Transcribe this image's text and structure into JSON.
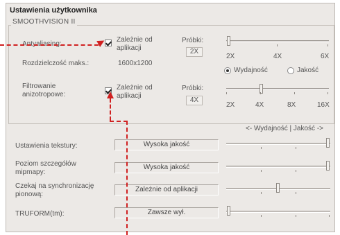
{
  "title": "Ustawienia użytkownika",
  "group_label": "SMOOTHVISION II",
  "antialiasing": {
    "label": "Antyaliasing:",
    "checkbox_label": "Zależnie od aplikacji",
    "probki_label": "Próbki:",
    "probki_value": "2X",
    "ticks": [
      "2X",
      "4X",
      "6X"
    ],
    "slider_level": 0
  },
  "resolution": {
    "label": "Rozdzielczość maks.:",
    "value": "1600x1200"
  },
  "mode": {
    "option1": "Wydajność",
    "option2": "Jakość",
    "selected": "Wydajność"
  },
  "anisotropic": {
    "label": "Filtrowanie anizotropowe:",
    "checkbox_label": "Zależnie od aplikacji",
    "probki_label": "Próbki:",
    "probki_value": "4X",
    "ticks": [
      "2X",
      "4X",
      "8X",
      "16X"
    ],
    "slider_level": 0.33
  },
  "scale_hint": "<- Wydajność | Jakość ->",
  "settings": [
    {
      "label": "Ustawienia tekstury:",
      "value": "Wysoka jakość",
      "level": 1.0
    },
    {
      "label": "Poziom szczegółów mipmapy:",
      "value": "Wysoka jakość",
      "level": 1.0
    },
    {
      "label": "Czekaj na synchronizację pionową:",
      "value": "Zależnie od aplikacji",
      "level": 0.5
    },
    {
      "label": "TRUFORM(tm):",
      "value": "Zawsze wył.",
      "level": 0
    }
  ],
  "colors": {
    "annotation": "#d02020",
    "panel": "#ece9e6"
  }
}
